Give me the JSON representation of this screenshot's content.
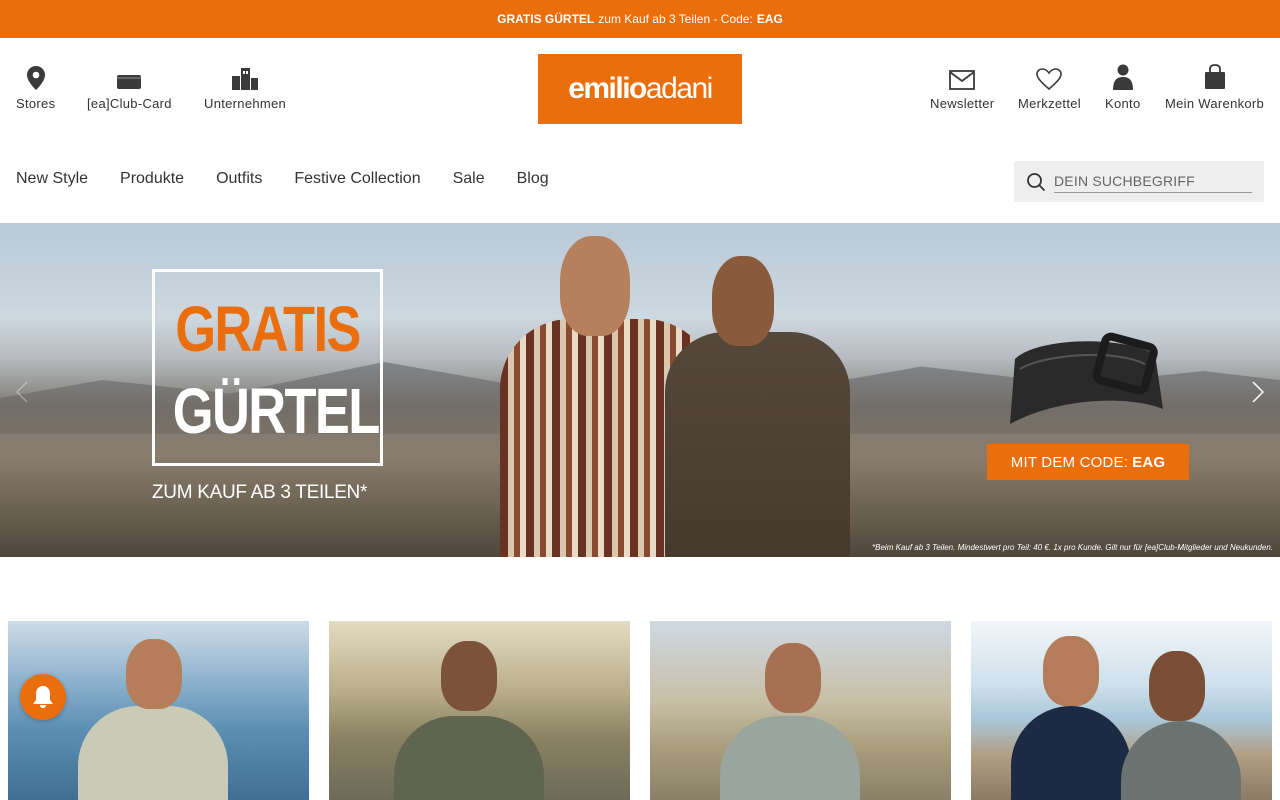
{
  "promo": {
    "bold": "GRATIS GÜRTEL",
    "text": "zum Kauf ab 3 Teilen - Code:",
    "code": "EAG"
  },
  "header": {
    "left_links": [
      {
        "label": "Stores",
        "icon": "location-pin-icon"
      },
      {
        "label": "[ea]Club-Card",
        "icon": "club-card-icon"
      },
      {
        "label": "Unternehmen",
        "icon": "building-icon"
      }
    ],
    "logo": {
      "first": "emilio",
      "second": "adani"
    },
    "right_links": [
      {
        "label": "Newsletter",
        "icon": "envelope-icon"
      },
      {
        "label": "Merkzettel",
        "icon": "heart-icon"
      },
      {
        "label": "Konto",
        "icon": "user-icon"
      },
      {
        "label": "Mein Warenkorb",
        "icon": "shopping-bag-icon"
      }
    ]
  },
  "nav": {
    "items": [
      "New Style",
      "Produkte",
      "Outfits",
      "Festive Collection",
      "Sale",
      "Blog"
    ]
  },
  "search": {
    "placeholder": "DEIN SUCHBEGRIFF",
    "value": ""
  },
  "hero": {
    "badge_line1": "GRATIS",
    "badge_line2": "GÜRTEL",
    "badge_sub": "ZUM KAUF AB 3 TEILEN*",
    "code_label": "MIT DEM CODE:",
    "code_value": "EAG",
    "disclaimer": "*Beim Kauf ab 3 Teilen. Mindestwert pro Teil: 40 €. 1x pro Kunde. Gilt nur für [ea]Club-Mitglieder und Neukunden."
  },
  "colors": {
    "brand_orange": "#ea6f0c"
  }
}
